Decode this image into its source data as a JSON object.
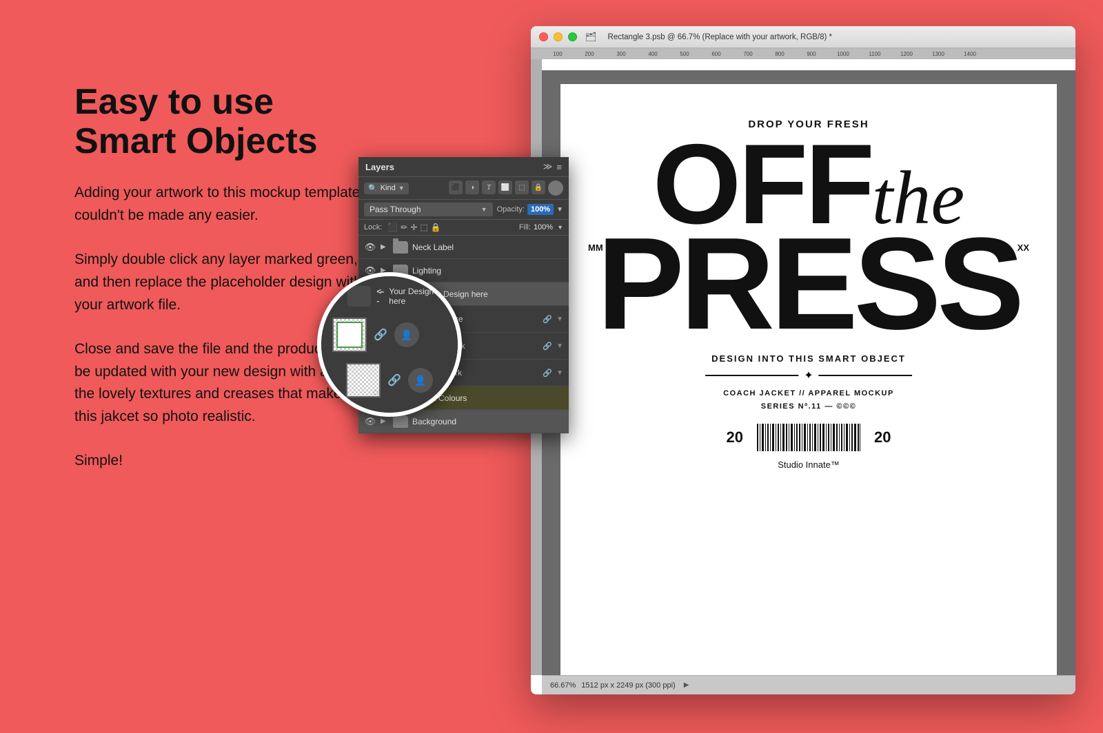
{
  "page": {
    "background_color": "#f05a5a"
  },
  "left_section": {
    "heading_line1": "Easy to use",
    "heading_line2": "Smart Objects",
    "paragraph1": "Adding your artwork to this mockup template couldn't be made any easier.",
    "paragraph2": "Simply double click any layer marked green, and then replace the placeholder design with your artwork file.",
    "paragraph3": "Close and save the file and the product will be updated with your new design with all of the lovely textures and creases that make this jakcet so photo realistic.",
    "paragraph4": "Simple!"
  },
  "ps_window": {
    "title": "Rectangle 3.psb @ 66.7% (Replace with your artwork, RGB/8) *",
    "status_text": "66.67%",
    "dimensions": "1512 px x 2249 px (300 ppi)",
    "ruler_labels": [
      "100",
      "200",
      "300",
      "400",
      "500",
      "600",
      "700",
      "800",
      "900",
      "1000",
      "1100",
      "1200",
      "1300",
      "1400"
    ]
  },
  "magazine": {
    "drop_text": "DROP YOUR FRESH",
    "off_text": "OFF",
    "the_text": "the",
    "press_text": "PRESS",
    "mm": "MM",
    "xx": "XX",
    "subtitle": "DESIGN INTO THIS SMART OBJECT",
    "product_line1": "COACH JACKET // APPAREL MOCKUP",
    "product_line2": "SERIES Nº.11 — ©©©",
    "year_left": "20",
    "year_right": "20",
    "studio": "Studio Innate™"
  },
  "layers_panel": {
    "title": "Layers",
    "icons": [
      "≡≡",
      "≡"
    ],
    "kind_label": "Kind",
    "blend_mode": "Pass Through",
    "opacity_label": "Opacity:",
    "opacity_value": "100%",
    "lock_label": "Lock:",
    "fill_label": "Fill:",
    "fill_value": "100%",
    "layers": [
      {
        "id": 1,
        "name": "Neck Label",
        "type": "folder",
        "visible": true,
        "has_arrow": true
      },
      {
        "id": 2,
        "name": "Lighting",
        "type": "folder",
        "visible": true,
        "has_arrow": true
      },
      {
        "id": 3,
        "name": "Your Design here",
        "type": "folder",
        "visible": true,
        "has_arrow": true,
        "selected": true
      },
      {
        "id": 4,
        "name": "Your ...Here",
        "type": "layer",
        "visible": true,
        "has_link": true,
        "has_arrow": true,
        "indent": 1
      },
      {
        "id": 5,
        "name": "Right...twork",
        "type": "layer",
        "visible": true,
        "has_link": true,
        "has_arrow": true,
        "indent": 1
      },
      {
        "id": 6,
        "name": "Left ...twork",
        "type": "layer",
        "visible": true,
        "has_link": true,
        "has_arrow": true,
        "indent": 1
      },
      {
        "id": 7,
        "name": "Jacket Colours",
        "type": "folder",
        "visible": true,
        "has_arrow": true,
        "special": "jacket"
      },
      {
        "id": 8,
        "name": "Background",
        "type": "folder",
        "visible": true,
        "has_arrow": true
      }
    ]
  }
}
